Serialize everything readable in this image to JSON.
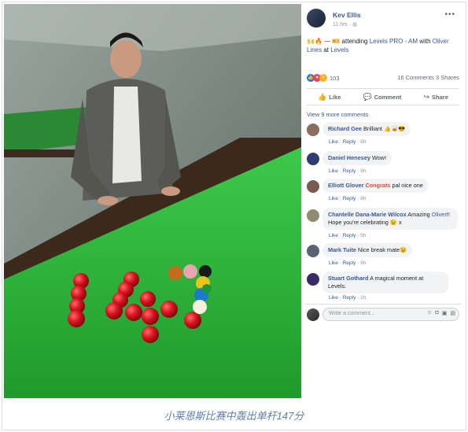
{
  "post": {
    "author": "Kev Ellis",
    "time": "11 hrs",
    "privacy_icon": "globe-icon",
    "more_icon": "ellipsis-icon",
    "text_prefix": "🙌🔥 — 🎫 attending ",
    "event_link": "Levels PRO - AM",
    "text_with": " with ",
    "with_link": "Oliver Lines",
    "text_at": " at ",
    "place_link": "Levels",
    "reaction_count": "103",
    "comments_count": "16 Comments",
    "shares_count": "3 Shares"
  },
  "actions": {
    "like": "Like",
    "comment": "Comment",
    "share": "Share"
  },
  "view_more": "View 9 more comments",
  "comments": [
    {
      "name": "Richard Gee",
      "text": "Brilliant 👍🥃😎",
      "like": "Like",
      "reply": "Reply",
      "age": "9h",
      "avatar_color": "#8a6d5a"
    },
    {
      "name": "Daniel Henesey",
      "text": "Wow!",
      "like": "Like",
      "reply": "Reply",
      "age": "9h",
      "avatar_color": "#2e3c6e"
    },
    {
      "name": "Elliott Glover",
      "tag": "Congrats",
      "text": " pal nice one",
      "like": "Like",
      "reply": "Reply",
      "age": "9h",
      "avatar_color": "#7a5a50"
    },
    {
      "name": "Chantelle Dana-Marie Wilcox",
      "text_a": " Amazing ",
      "tag": "Oliver",
      "text_b": "!! Hope you're celebrating 😉 x",
      "like": "Like",
      "reply": "Reply",
      "age": "5h",
      "avatar_color": "#8f8a70"
    },
    {
      "name": "Mark Tuite",
      "text": " Nice break mate😉",
      "like": "Like",
      "reply": "Reply",
      "age": "9h",
      "avatar_color": "#5a6470"
    },
    {
      "name": "Stuart Gothard",
      "text": " A magical moment at Levels.",
      "like": "Like",
      "reply": "Reply",
      "age": "2h",
      "avatar_color": "#3a2a6a"
    }
  ],
  "composer": {
    "placeholder": "Write a comment...",
    "tools": [
      "emoji-icon",
      "camera-icon",
      "gif-icon",
      "sticker-icon"
    ]
  },
  "caption": "小莱恩斯比赛中轰出单杆147分",
  "colors": {
    "link": "#385898",
    "table_green": "#2fbf3a",
    "red_ball": "#d8131f",
    "caption": "#5b7fb0"
  }
}
